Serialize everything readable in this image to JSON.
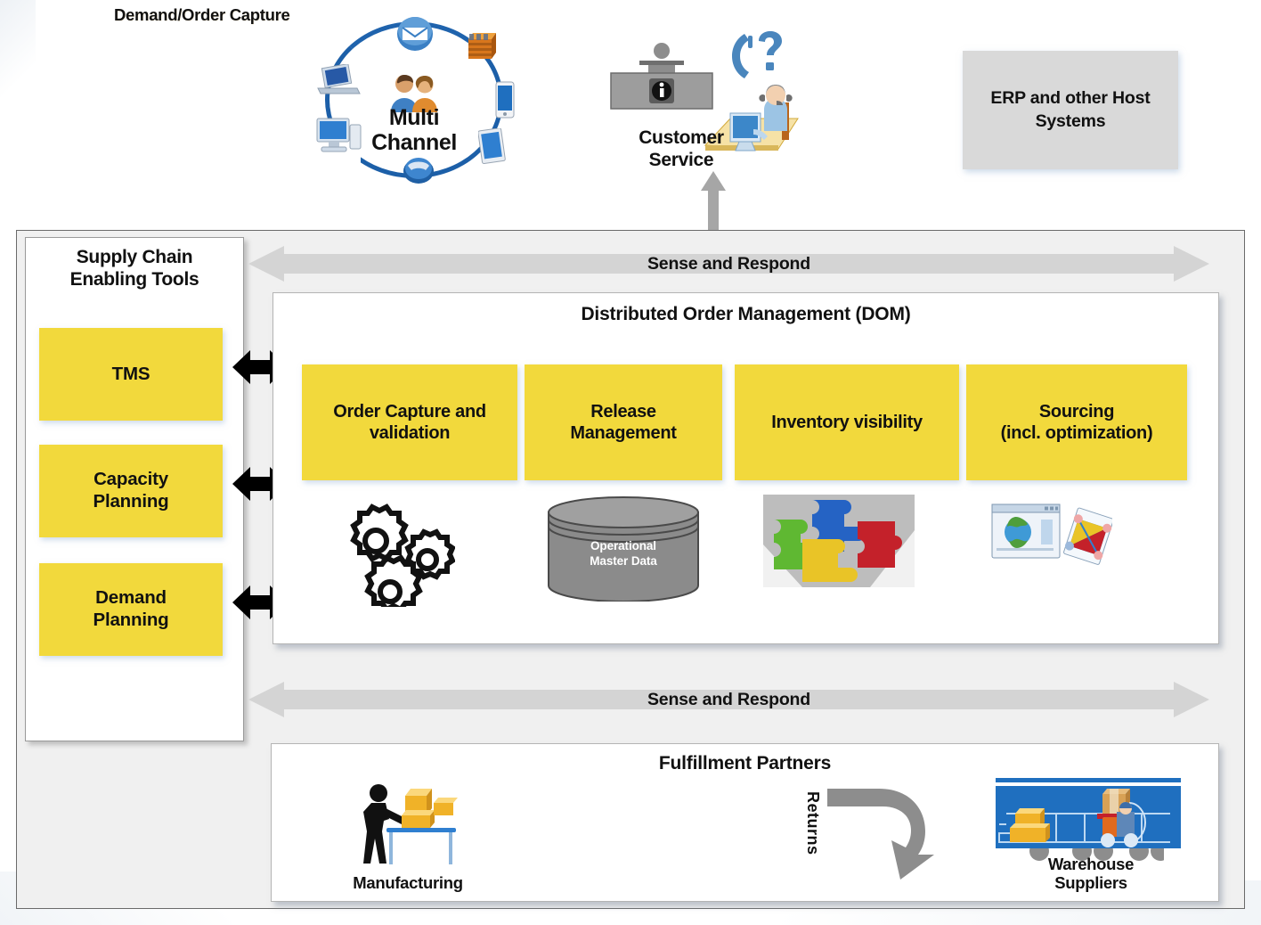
{
  "top": {
    "demand_capture_title": "Demand/Order Capture",
    "multichannel": {
      "label_line1": "Multi",
      "label_line2": "Channel",
      "nodes": [
        "email-icon",
        "store-icon",
        "smartphone-icon",
        "tablet-icon",
        "telephone-icon",
        "desktop-icon",
        "laptop-icon"
      ],
      "center_icon": "customers-icon"
    },
    "customer_service": {
      "label_line1": "Customer",
      "label_line2": "Service",
      "icons": [
        "information-desk-icon",
        "question-mark-icon",
        "agent-at-computer-icon"
      ]
    },
    "erp": {
      "label": "ERP and other Host Systems",
      "label_line1": "ERP and other Host",
      "label_line2": "Systems"
    },
    "connector": "vertical-double-arrow"
  },
  "sidebar": {
    "title_line1": "Supply Chain",
    "title_line2": "Enabling Tools",
    "tools": [
      {
        "id": "tms",
        "label": "TMS",
        "lines": [
          "TMS"
        ]
      },
      {
        "id": "capacity-planning",
        "label": "Capacity Planning",
        "lines": [
          "Capacity",
          "Planning"
        ]
      },
      {
        "id": "demand-planning",
        "label": "Demand Planning",
        "lines": [
          "Demand",
          "Planning"
        ]
      }
    ]
  },
  "bars": {
    "sense_and_respond_top": "Sense and Respond",
    "sense_and_respond_bottom": "Sense and Respond"
  },
  "dom": {
    "title": "Distributed Order Management (DOM)",
    "boxes": [
      {
        "lines": [
          "Order Capture and",
          "validation"
        ],
        "icon": "gears-icon"
      },
      {
        "lines": [
          "Release",
          "Management"
        ],
        "icon": "database-cylinder-icon"
      },
      {
        "lines": [
          "Inventory visibility"
        ],
        "icon": "puzzle-pieces-icon"
      },
      {
        "lines": [
          "Sourcing",
          "(incl. optimization)"
        ],
        "icon": "globe-window-and-chart-icon"
      }
    ],
    "database_label_line1": "Operational",
    "database_label_line2": "Master Data"
  },
  "fulfillment": {
    "title": "Fulfillment Partners",
    "items": [
      {
        "caption": "Manufacturing",
        "icon": "worker-with-boxes-icon"
      },
      {
        "caption": "Returns",
        "icon": "return-arrow-icon"
      },
      {
        "caption": "Suppliers",
        "icon": "truck-with-boxes-icon"
      },
      {
        "caption": "Warehouse",
        "icon": "warehouse-forklift-icon"
      }
    ]
  },
  "colors": {
    "accent_yellow": "#F2D93C",
    "panel_grey": "#F0F0F0",
    "erp_grey": "#D9D9D9",
    "arrow_grey": "#D2D2D2",
    "ring_blue": "#1C5FA8",
    "warehouse_blue": "#1F6FBF"
  }
}
